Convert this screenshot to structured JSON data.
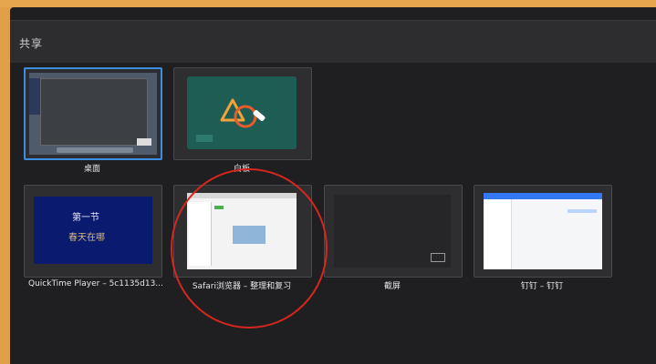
{
  "dialog": {
    "title": "共享"
  },
  "tiles": [
    {
      "label": "桌面"
    },
    {
      "label": "白板"
    },
    {
      "label": "QuickTime Player – 5c1135d13..."
    },
    {
      "label": "Safari浏览器 – 整理和复习"
    },
    {
      "label": "截屏"
    },
    {
      "label": "钉钉 – 钉钉"
    }
  ],
  "video": {
    "line1": "第一节",
    "line2": "春天在哪"
  },
  "colors": {
    "accent": "#3b8fe3",
    "annotation": "#d7261e",
    "whiteboard": "#1e5d54"
  },
  "icons": [
    "whiteboard-shapes-icon"
  ]
}
